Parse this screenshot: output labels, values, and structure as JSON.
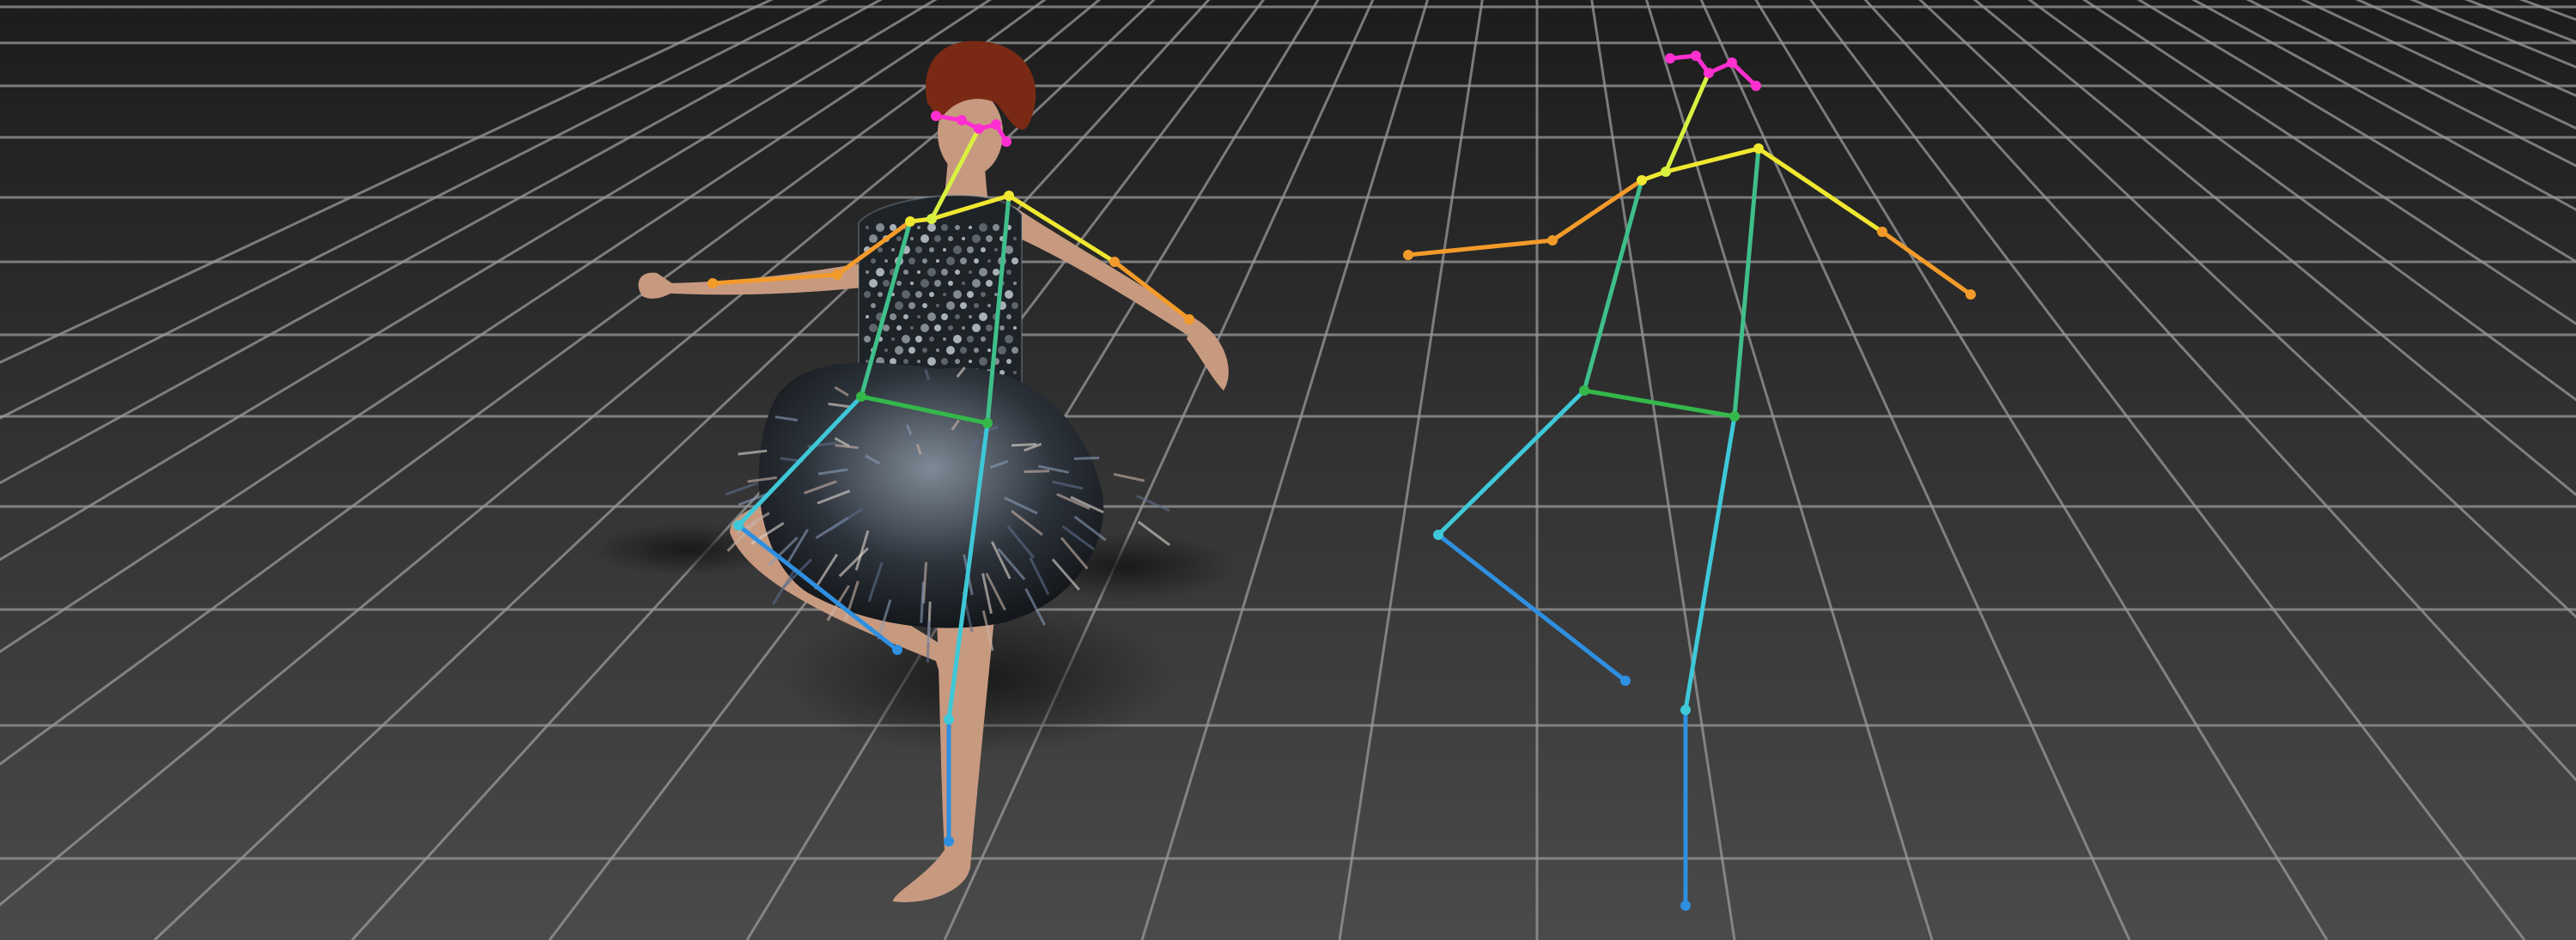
{
  "scene": {
    "background_top": "#1c1c1c",
    "background_bottom": "#4a4a4a",
    "grid_color": "#9a9a9a",
    "figure_skin": "#c79a80",
    "figure_hair": "#7a2a14",
    "dress_color": "#2c3036",
    "shadow_color": "#1a1a1a"
  },
  "skeleton_palette": {
    "head": "#ff2fd0",
    "neck": "#d8f040",
    "arms": "#f0e830",
    "forearms": "#f39b2a",
    "torso": "#3fbf8a",
    "hips": "#34b84a",
    "legs": "#3ec8d8",
    "lower_legs": "#2f8fe0"
  },
  "labels": {
    "photo_figure": "dancer-with-pose-overlay",
    "skeleton_figure": "standalone-pose-skeleton"
  }
}
